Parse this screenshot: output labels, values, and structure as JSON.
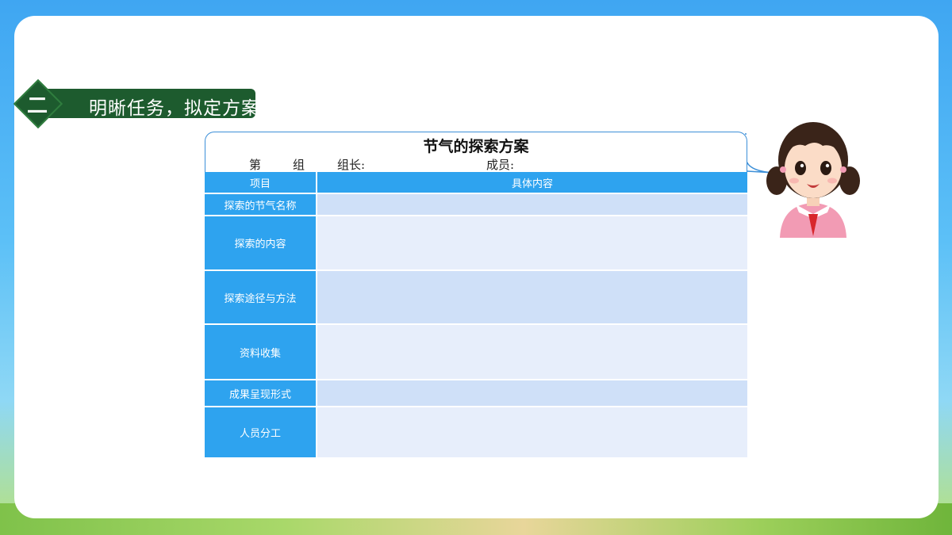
{
  "section": {
    "number": "二",
    "title": "明晰任务，拟定方案"
  },
  "plan": {
    "title": "节气的探索方案",
    "group_prefix": "第",
    "group_suffix": "组",
    "leader_label": "组长:",
    "members_label": "成员:",
    "headers": {
      "item": "项目",
      "content": "具体内容"
    },
    "rows": [
      {
        "label": "探索的节气名称",
        "content": ""
      },
      {
        "label": "探索的内容",
        "content": ""
      },
      {
        "label": "探索途径与方法",
        "content": ""
      },
      {
        "label": "资料收集",
        "content": ""
      },
      {
        "label": "成果呈现形式",
        "content": ""
      },
      {
        "label": "人员分工",
        "content": ""
      }
    ]
  },
  "colors": {
    "header_green": "#1d5b2e",
    "table_blue": "#2ea3ef",
    "row_light": "#cfe0f8",
    "row_lighter": "#e7eefb"
  },
  "icons": [
    "girl-illustration"
  ]
}
